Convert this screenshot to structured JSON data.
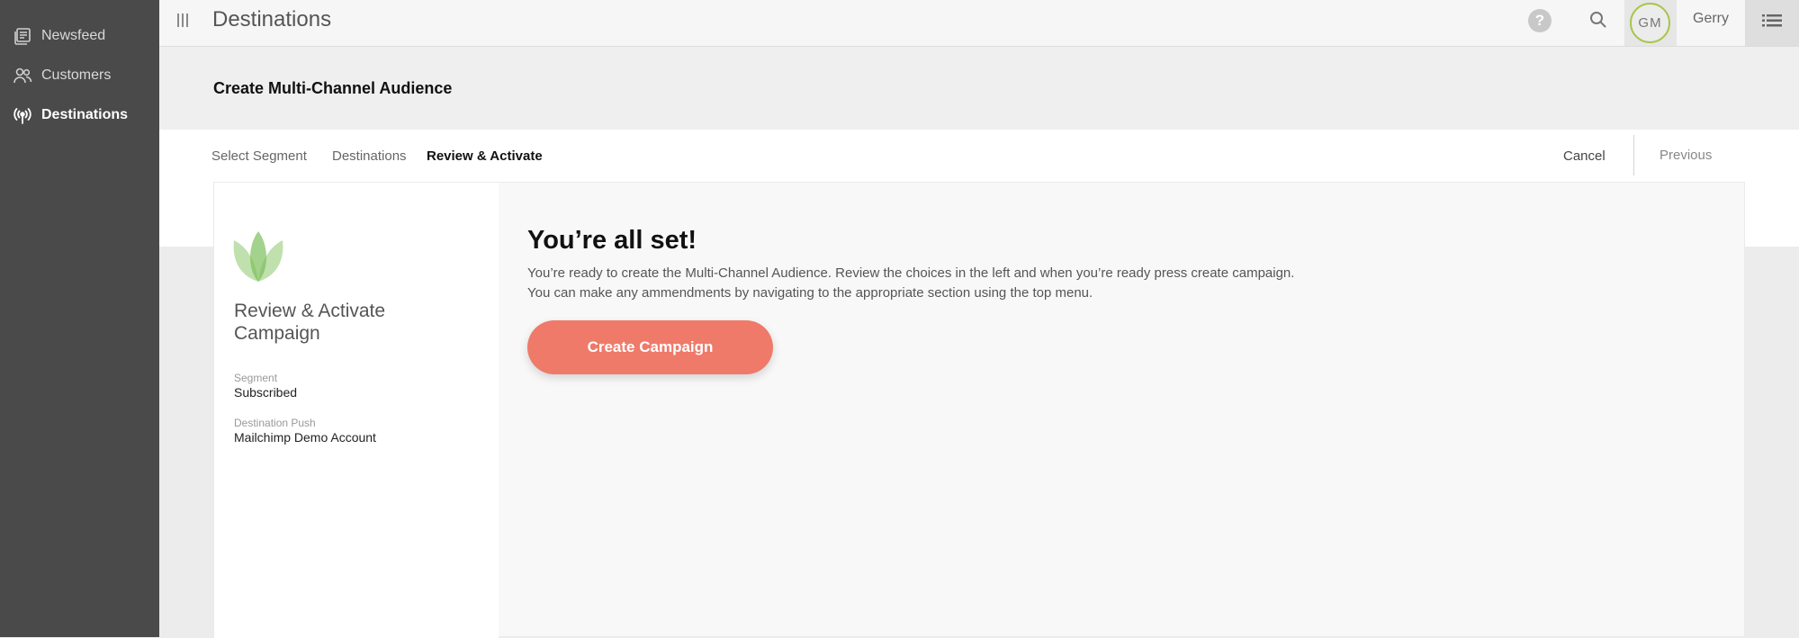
{
  "sidebar": {
    "items": [
      {
        "label": "Newsfeed",
        "icon": "newsfeed-icon"
      },
      {
        "label": "Customers",
        "icon": "customers-icon"
      },
      {
        "label": "Destinations",
        "icon": "broadcast-icon",
        "active": true
      }
    ]
  },
  "header": {
    "title": "Destinations",
    "help_label": "?",
    "avatar_initials": "GM",
    "user_name": "Gerry"
  },
  "page": {
    "title": "Create Multi-Channel Audience"
  },
  "steps": {
    "items": [
      "Select Segment",
      "Destinations",
      "Review & Activate"
    ],
    "current": "Review & Activate",
    "cancel_label": "Cancel",
    "previous_label": "Previous"
  },
  "summary": {
    "title": "Review & Activate Campaign",
    "segment_label": "Segment",
    "segment_value": "Subscribed",
    "destination_label": "Destination Push",
    "destination_value": "Mailchimp Demo Account"
  },
  "main": {
    "headline": "You’re all set!",
    "line1": "You’re ready to create the Multi-Channel Audience. Review the choices in the left and when you’re ready press create campaign.",
    "line2": "You can make any ammendments by navigating to the appropriate section using the top menu.",
    "button_label": "Create Campaign"
  },
  "colors": {
    "sidebar_bg": "#4a4a4a",
    "accent_button": "#ef7a6a",
    "avatar_ring": "#a8c64a",
    "logo_green": "#8cc66a"
  }
}
